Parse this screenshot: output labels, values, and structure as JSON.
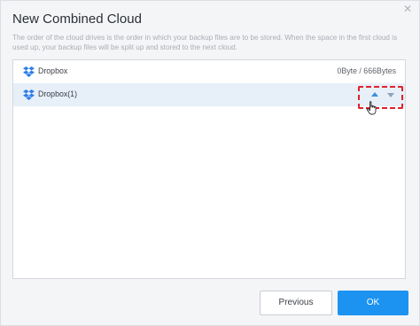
{
  "dialog": {
    "title": "New Combined Cloud",
    "description": "The order of the cloud drives is the order in which your backup files are to be stored. When the space in the first cloud is used up, your backup files will be split up and stored to the next cloud."
  },
  "clouds": [
    {
      "name": "Dropbox",
      "size": "0Byte / 666Bytes",
      "icon": "dropbox-icon"
    },
    {
      "name": "Dropbox(1)",
      "size": "",
      "icon": "dropbox-icon",
      "selected": true
    }
  ],
  "buttons": {
    "previous": "Previous",
    "ok": "OK"
  },
  "colors": {
    "accent": "#1d93f1",
    "selected_row": "#e7eff9",
    "highlight_box": "#e0212b",
    "dropbox": "#2f7fe8"
  }
}
